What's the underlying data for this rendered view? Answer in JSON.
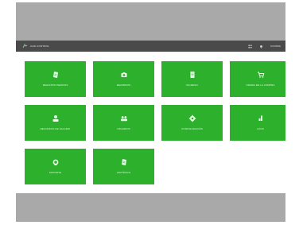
{
  "app": {
    "brand": "CAR CONTROL",
    "user": "NOMBRE"
  },
  "header_icons": [
    "grid-icon",
    "bell-icon"
  ],
  "tiles": [
    {
      "label": "REGISTRO PEDIDOS",
      "icon": "clipboard-icon"
    },
    {
      "label": "RECIBIDOS",
      "icon": "camera-icon"
    },
    {
      "label": "INGRESO",
      "icon": "document-icon"
    },
    {
      "label": "ORDEN DE LA COMPRA",
      "icon": "cart-icon"
    },
    {
      "label": "RECURSOS DE SALARIO",
      "icon": "person-icon"
    },
    {
      "label": "USUARIOS",
      "icon": "users-icon"
    },
    {
      "label": "CONFIGURACIÓN",
      "icon": "gear-icon"
    },
    {
      "label": "LOGS",
      "icon": "bar-icon"
    },
    {
      "label": "SOPORTE",
      "icon": "headset-icon"
    },
    {
      "label": "HISTÓRICO",
      "icon": "notebook-icon"
    }
  ],
  "colors": {
    "tile": "#2db12d",
    "bezel": "#a9a9a9",
    "appbar": "#4a4a4a"
  }
}
